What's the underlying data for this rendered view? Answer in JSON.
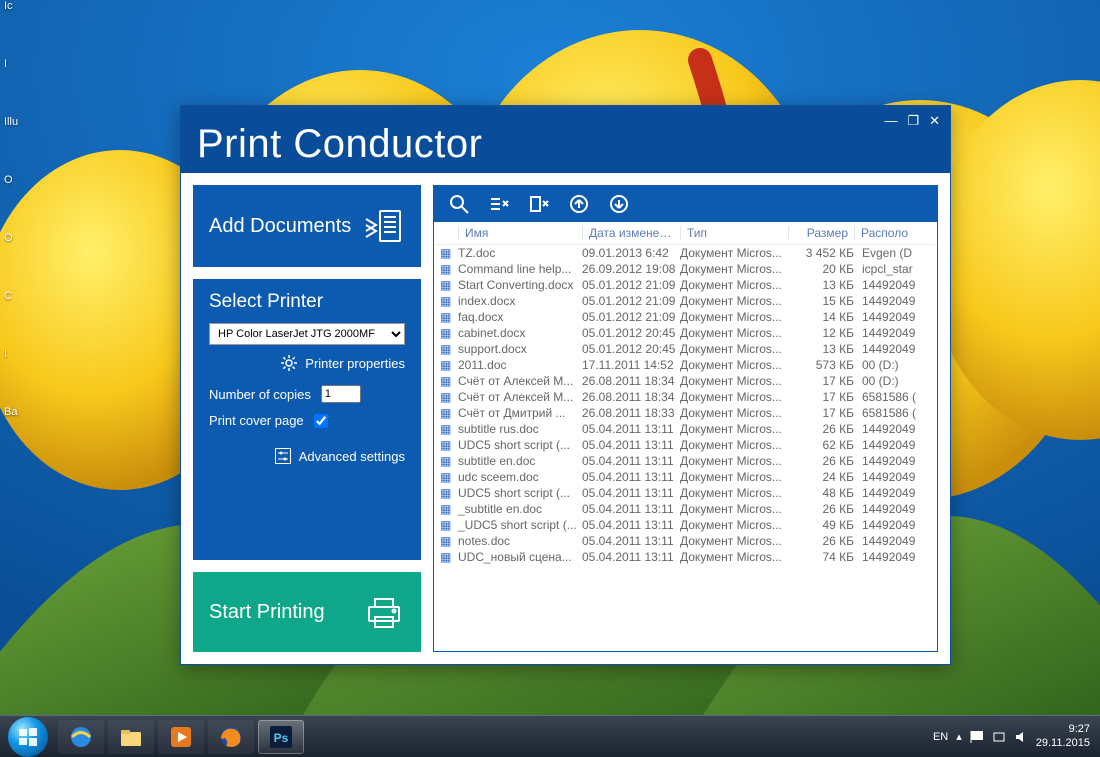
{
  "app": {
    "title": "Print Conductor",
    "add_documents_label": "Add Documents",
    "start_printing_label": "Start Printing"
  },
  "select_printer": {
    "header": "Select Printer",
    "selected": "HP Color LaserJet JTG 2000MF",
    "properties_label": "Printer properties",
    "copies_label": "Number of copies",
    "copies_value": "1",
    "cover_label": "Print cover page",
    "cover_checked": true,
    "advanced_label": "Advanced settings"
  },
  "file_columns": {
    "name": "Имя",
    "modified": "Дата изменения",
    "type": "Тип",
    "size": "Размер",
    "location": "Располо"
  },
  "files": [
    {
      "name": "TZ.doc",
      "date": "09.01.2013 6:42",
      "type": "Документ Micros...",
      "size": "3 452 КБ",
      "loc": "Evgen (D"
    },
    {
      "name": "Command line help...",
      "date": "26.09.2012 19:08",
      "type": "Документ Micros...",
      "size": "20 КБ",
      "loc": "icpcl_star"
    },
    {
      "name": "Start Converting.docx",
      "date": "05.01.2012 21:09",
      "type": "Документ Micros...",
      "size": "13 КБ",
      "loc": "14492049"
    },
    {
      "name": "index.docx",
      "date": "05.01.2012 21:09",
      "type": "Документ Micros...",
      "size": "15 КБ",
      "loc": "14492049"
    },
    {
      "name": "faq.docx",
      "date": "05.01.2012 21:09",
      "type": "Документ Micros...",
      "size": "14 КБ",
      "loc": "14492049"
    },
    {
      "name": "cabinet.docx",
      "date": "05.01.2012 20:45",
      "type": "Документ Micros...",
      "size": "12 КБ",
      "loc": "14492049"
    },
    {
      "name": "support.docx",
      "date": "05.01.2012 20:45",
      "type": "Документ Micros...",
      "size": "13 КБ",
      "loc": "14492049"
    },
    {
      "name": "2011.doc",
      "date": "17.11.2011 14:52",
      "type": "Документ Micros...",
      "size": "573 КБ",
      "loc": "00 (D:)"
    },
    {
      "name": "Счёт от Алексей М...",
      "date": "26.08.2011 18:34",
      "type": "Документ Micros...",
      "size": "17 КБ",
      "loc": "00 (D:)"
    },
    {
      "name": "Счёт от Алексей М...",
      "date": "26.08.2011 18:34",
      "type": "Документ Micros...",
      "size": "17 КБ",
      "loc": "6581586 ("
    },
    {
      "name": "Счёт от Дмитрий ...",
      "date": "26.08.2011 18:33",
      "type": "Документ Micros...",
      "size": "17 КБ",
      "loc": "6581586 ("
    },
    {
      "name": "subtitle rus.doc",
      "date": "05.04.2011 13:11",
      "type": "Документ Micros...",
      "size": "26 КБ",
      "loc": "14492049"
    },
    {
      "name": "UDC5 short script (...",
      "date": "05.04.2011 13:11",
      "type": "Документ Micros...",
      "size": "62 КБ",
      "loc": "14492049"
    },
    {
      "name": "subtitle en.doc",
      "date": "05.04.2011 13:11",
      "type": "Документ Micros...",
      "size": "26 КБ",
      "loc": "14492049"
    },
    {
      "name": "udc sceem.doc",
      "date": "05.04.2011 13:11",
      "type": "Документ Micros...",
      "size": "24 КБ",
      "loc": "14492049"
    },
    {
      "name": "UDC5 short script (...",
      "date": "05.04.2011 13:11",
      "type": "Документ Micros...",
      "size": "48 КБ",
      "loc": "14492049"
    },
    {
      "name": "_subtitle en.doc",
      "date": "05.04.2011 13:11",
      "type": "Документ Micros...",
      "size": "26 КБ",
      "loc": "14492049"
    },
    {
      "name": "_UDC5 short script (...",
      "date": "05.04.2011 13:11",
      "type": "Документ Micros...",
      "size": "49 КБ",
      "loc": "14492049"
    },
    {
      "name": "notes.doc",
      "date": "05.04.2011 13:11",
      "type": "Документ Micros...",
      "size": "26 КБ",
      "loc": "14492049"
    },
    {
      "name": "UDC_новый сцена...",
      "date": "05.04.2011 13:11",
      "type": "Документ Micros...",
      "size": "74 КБ",
      "loc": "14492049"
    }
  ],
  "desktop_icons": [
    "Ic",
    " ",
    "I",
    " ",
    "Illu",
    " ",
    "O",
    " ",
    "O",
    " ",
    "C",
    " ",
    "I",
    "Ba"
  ],
  "taskbar": {
    "lang": "EN",
    "time": "9:27",
    "date": "29.11.2015"
  }
}
